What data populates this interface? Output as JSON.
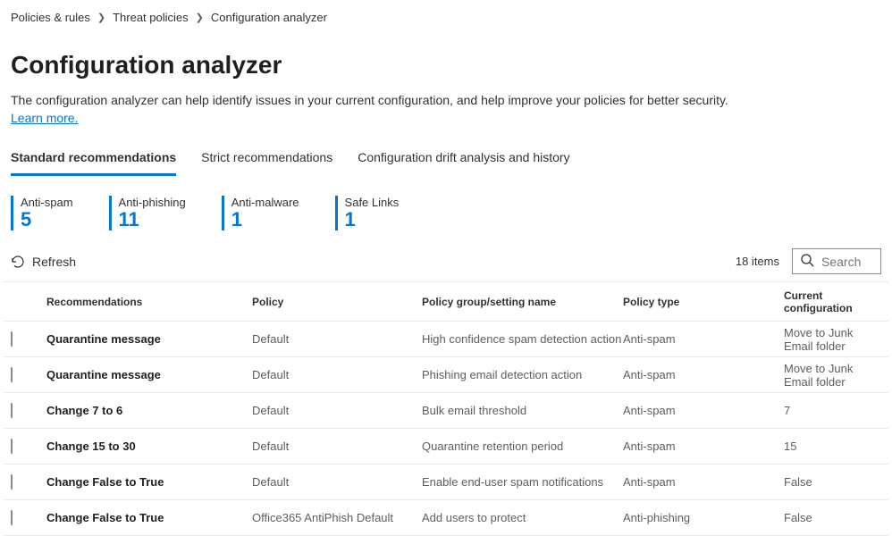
{
  "breadcrumb": {
    "items": [
      "Policies & rules",
      "Threat policies",
      "Configuration analyzer"
    ]
  },
  "page": {
    "title": "Configuration analyzer",
    "description": "The configuration analyzer can help identify issues in your current configuration, and help improve your policies for better security. ",
    "learn_more": "Learn more."
  },
  "tabs": [
    {
      "label": "Standard recommendations",
      "active": true
    },
    {
      "label": "Strict recommendations",
      "active": false
    },
    {
      "label": "Configuration drift analysis and history",
      "active": false
    }
  ],
  "stats": [
    {
      "label": "Anti-spam",
      "value": "5"
    },
    {
      "label": "Anti-phishing",
      "value": "11"
    },
    {
      "label": "Anti-malware",
      "value": "1"
    },
    {
      "label": "Safe Links",
      "value": "1"
    }
  ],
  "toolbar": {
    "refresh_label": "Refresh",
    "item_count": "18 items",
    "search_placeholder": "Search"
  },
  "columns": {
    "recommendations": "Recommendations",
    "policy": "Policy",
    "group": "Policy group/setting name",
    "type": "Policy type",
    "current": "Current configuration"
  },
  "rows": [
    {
      "rec": "Quarantine message",
      "policy": "Default",
      "group": "High confidence spam detection action",
      "type": "Anti-spam",
      "current": "Move to Junk Email folder"
    },
    {
      "rec": "Quarantine message",
      "policy": "Default",
      "group": "Phishing email detection action",
      "type": "Anti-spam",
      "current": "Move to Junk Email folder"
    },
    {
      "rec": "Change 7 to 6",
      "policy": "Default",
      "group": "Bulk email threshold",
      "type": "Anti-spam",
      "current": "7"
    },
    {
      "rec": "Change 15 to 30",
      "policy": "Default",
      "group": "Quarantine retention period",
      "type": "Anti-spam",
      "current": "15"
    },
    {
      "rec": "Change False to True",
      "policy": "Default",
      "group": "Enable end-user spam notifications",
      "type": "Anti-spam",
      "current": "False"
    },
    {
      "rec": "Change False to True",
      "policy": "Office365 AntiPhish Default",
      "group": "Add users to protect",
      "type": "Anti-phishing",
      "current": "False"
    }
  ]
}
